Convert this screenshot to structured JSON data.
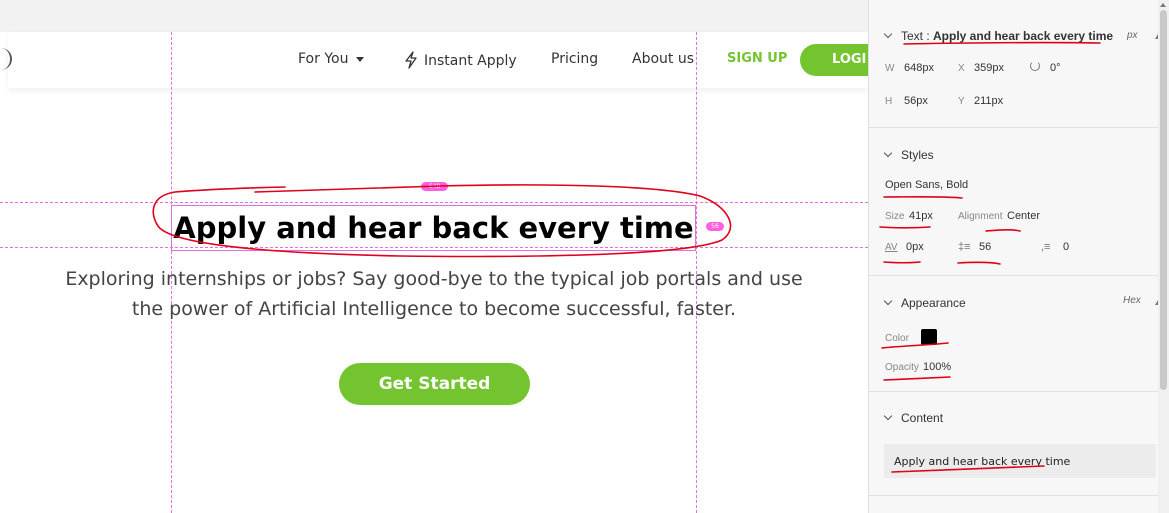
{
  "nav": {
    "items": [
      "For You",
      "Instant Apply",
      "Pricing",
      "About us"
    ],
    "signup": "SIGN UP",
    "login": "LOGI"
  },
  "hero": {
    "title": "Apply and hear back every time",
    "subtitle_line1": "Exploring internships or jobs? Say good-bye to the typical job portals and use",
    "subtitle_line2": "the power of Artificial Intelligence to become successful, faster.",
    "cta": "Get Started",
    "width_badge": "648",
    "height_badge": "56"
  },
  "inspector": {
    "text_section": {
      "prefix": "Text : ",
      "name": "Apply and hear back every time",
      "unit": "px",
      "w_label": "W",
      "w_value": "648px",
      "x_label": "X",
      "x_value": "359px",
      "rotation": "0°",
      "h_label": "H",
      "h_value": "56px",
      "y_label": "Y",
      "y_value": "211px"
    },
    "styles_section": {
      "title": "Styles",
      "font": "Open Sans, Bold",
      "size_label": "Size",
      "size_value": "41px",
      "alignment_label": "Alignment",
      "alignment_value": "Center",
      "tracking_label": "AV",
      "tracking_value": "0px",
      "line_height_value": "56",
      "paragraph_value": "0"
    },
    "appearance_section": {
      "title": "Appearance",
      "mode": "Hex",
      "color_label": "Color",
      "color_value": "#000000",
      "opacity_label": "Opacity",
      "opacity_value": "100%"
    },
    "content_section": {
      "title": "Content",
      "text": "Apply and hear back every time"
    }
  },
  "colors": {
    "brand_green": "#74c42f",
    "guide_pink": "#e070e0",
    "badge_pink": "#ff5fe0",
    "annotation_red": "#e0001a"
  }
}
